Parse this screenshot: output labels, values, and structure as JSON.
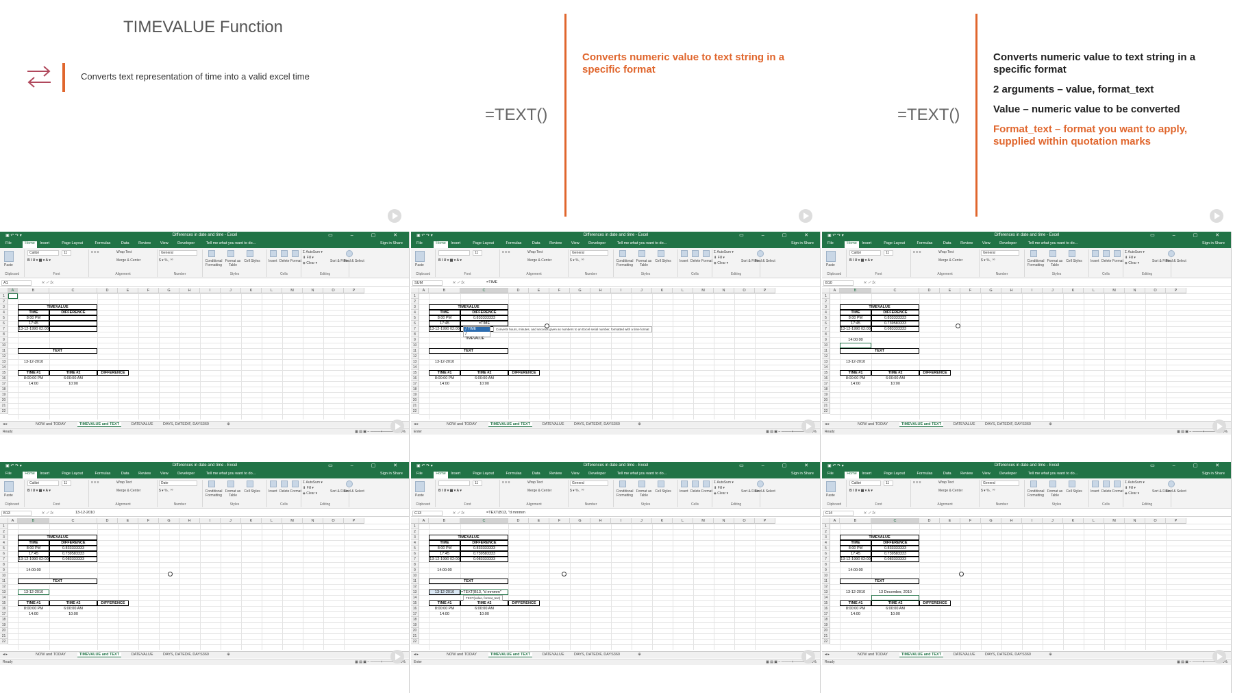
{
  "slides": {
    "s1": {
      "title": "TIMEVALUE Function",
      "description": "Converts text representation of time into a valid excel time",
      "formula": "=TEXT()"
    },
    "s2": {
      "description": "Converts numeric value to text string in a specific format",
      "formula": "=TEXT()"
    },
    "s3": {
      "line1": "Converts numeric value to text string in a specific format",
      "line2": "2 arguments – value, format_text",
      "line3": "Value – numeric value to be converted",
      "line4": "Format_text – format you want to apply, supplied within quotation marks"
    }
  },
  "excel": {
    "title": "Differences in date and time - Excel",
    "ribbon_tabs": [
      "File",
      "Home",
      "Insert",
      "Page Layout",
      "Formulas",
      "Data",
      "Review",
      "View",
      "Developer",
      "Tell me what you want to do..."
    ],
    "sign_in": "Sign in",
    "share": "Share",
    "ribbon_groups": [
      "Clipboard",
      "Font",
      "Alignment",
      "Number",
      "Styles",
      "Cells",
      "Editing"
    ],
    "font_name": "Calibri",
    "font_size": "11",
    "wrap_text": "Wrap Text",
    "merge_center": "Merge & Center",
    "cond_format": "Conditional Formatting",
    "format_table": "Format as Table",
    "cell_styles": "Cell Styles",
    "insert": "Insert",
    "delete": "Delete",
    "format": "Format",
    "autosum": "AutoSum",
    "fill": "Fill",
    "clear": "Clear",
    "sort_filter": "Sort & Filter",
    "find_select": "Find & Select",
    "paste": "Paste",
    "columns": [
      "A",
      "B",
      "C",
      "D",
      "E",
      "F",
      "G",
      "H",
      "I",
      "J",
      "K",
      "L",
      "M",
      "N",
      "O",
      "P"
    ],
    "rows": [
      "1",
      "2",
      "3",
      "4",
      "5",
      "6",
      "7",
      "8",
      "9",
      "10",
      "11",
      "12",
      "13",
      "14",
      "15",
      "16",
      "17",
      "18",
      "19",
      "20",
      "21",
      "22"
    ],
    "sheet_tabs": [
      "NOW and TODAY",
      "TIMEVALUE and TEXT",
      "DATEVALUE",
      "DAYS, DATEDIF, DAYS360"
    ],
    "status_ready": "Ready",
    "status_enter": "Enter",
    "zoom": "100%",
    "table1": {
      "title": "TIMEVALUE",
      "headers": [
        "TIME",
        "DIFFERENCE"
      ],
      "rows": [
        [
          "8:00 PM",
          "0.833333333"
        ],
        [
          "17:45",
          "0.739583333"
        ],
        [
          "13-12-1990 02:00",
          "0.083333333"
        ]
      ]
    },
    "cell_b9": "14:00:00",
    "text_title": "TEXT",
    "cell_b13": "13-12-2010",
    "cell_c13_result": "13 December, 2010",
    "table2": {
      "headers": [
        "TIME #1",
        "TIME #2",
        "DIFFERENCE"
      ],
      "rows": [
        [
          "8:00:00 PM",
          "6:00:00 AM"
        ],
        [
          "14:00",
          "10:00"
        ]
      ]
    },
    "panes": [
      {
        "namebox": "A1",
        "formula": "",
        "number_format": "General"
      },
      {
        "namebox": "SUM",
        "formula": "=TIME",
        "number_format": "General"
      },
      {
        "namebox": "B10",
        "formula": "",
        "number_format": "General"
      },
      {
        "namebox": "B13",
        "formula": "13-12-2010",
        "number_format": "Date"
      },
      {
        "namebox": "C13",
        "formula": "=TEXT(B13, \"d mmmm",
        "number_format": "General"
      },
      {
        "namebox": "C14",
        "formula": "",
        "number_format": "General"
      }
    ],
    "typing_c6": "=TIME",
    "autocomplete": [
      "TIME",
      "TIMEVALUE"
    ],
    "autocomplete_tip": "Converts hours, minutes, and seconds given as numbers to an Excel serial number, formatted with a time format",
    "typing_c13": "=TEXT(B13, \"d mmmm\"",
    "arg_tip": "TEXT(value, format_text)"
  },
  "colors": {
    "excel_green": "#217346",
    "accent_orange": "#e0662d"
  }
}
